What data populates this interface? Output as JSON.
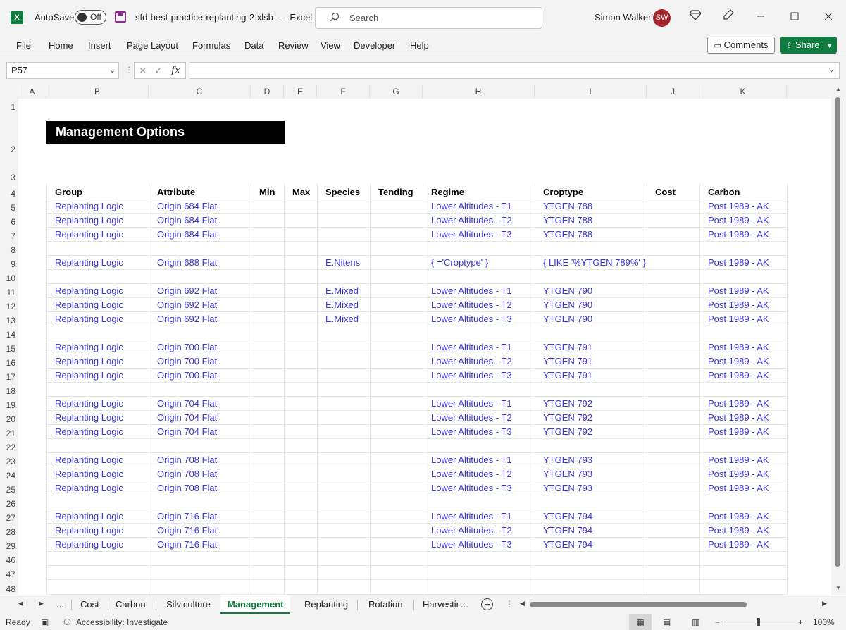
{
  "titlebar": {
    "autosave_label": "AutoSave",
    "autosave_state": "Off",
    "filename": "sfd-best-practice-replanting-2.xlsb",
    "separator": "-",
    "app": "Excel",
    "search_placeholder": "Search",
    "user_name": "Simon Walker",
    "user_initials": "SW",
    "brand_color": "#107c41"
  },
  "menu": {
    "items": [
      "File",
      "Home",
      "Insert",
      "Page Layout",
      "Formulas",
      "Data",
      "Review",
      "View",
      "Developer",
      "Help"
    ],
    "comments": "Comments",
    "share": "Share"
  },
  "formula_bar": {
    "name_box": "P57",
    "fx": "fx",
    "formula": ""
  },
  "columns": [
    "A",
    "B",
    "C",
    "D",
    "E",
    "F",
    "G",
    "H",
    "I",
    "J",
    "K"
  ],
  "row_numbers": [
    "1",
    "2",
    "3",
    "4",
    "5",
    "6",
    "7",
    "8",
    "9",
    "10",
    "11",
    "12",
    "13",
    "14",
    "15",
    "16",
    "17",
    "18",
    "19",
    "20",
    "21",
    "22",
    "23",
    "24",
    "25",
    "26",
    "27",
    "28",
    "29",
    "46",
    "47",
    "48"
  ],
  "sheet": {
    "title": "Management Options",
    "headers": [
      "Group",
      "Attribute",
      "Min",
      "Max",
      "Species",
      "Tending",
      "Regime",
      "Croptype",
      "Cost",
      "Carbon"
    ],
    "rows": [
      [
        "Replanting Logic",
        "Origin 684 Flat",
        "",
        "",
        "",
        "",
        "Lower Altitudes - T1",
        "YTGEN 788",
        "",
        "Post 1989 - AK"
      ],
      [
        "Replanting Logic",
        "Origin 684 Flat",
        "",
        "",
        "",
        "",
        "Lower Altitudes - T2",
        "YTGEN 788",
        "",
        "Post 1989 - AK"
      ],
      [
        "Replanting Logic",
        "Origin 684 Flat",
        "",
        "",
        "",
        "",
        "Lower Altitudes - T3",
        "YTGEN 788",
        "",
        "Post 1989 - AK"
      ],
      [
        "",
        "",
        "",
        "",
        "",
        "",
        "",
        "",
        "",
        ""
      ],
      [
        "Replanting Logic",
        "Origin 688 Flat",
        "",
        "",
        "E.Nitens",
        "",
        "{ ='Croptype' }",
        "{ LIKE '%YTGEN 789%' }",
        "",
        "Post 1989 - AK"
      ],
      [
        "",
        "",
        "",
        "",
        "",
        "",
        "",
        "",
        "",
        ""
      ],
      [
        "Replanting Logic",
        "Origin 692 Flat",
        "",
        "",
        "E.Mixed",
        "",
        "Lower Altitudes - T1",
        "YTGEN 790",
        "",
        "Post 1989 - AK"
      ],
      [
        "Replanting Logic",
        "Origin 692 Flat",
        "",
        "",
        "E.Mixed",
        "",
        "Lower Altitudes - T2",
        "YTGEN 790",
        "",
        "Post 1989 - AK"
      ],
      [
        "Replanting Logic",
        "Origin 692 Flat",
        "",
        "",
        "E.Mixed",
        "",
        "Lower Altitudes - T3",
        "YTGEN 790",
        "",
        "Post 1989 - AK"
      ],
      [
        "",
        "",
        "",
        "",
        "",
        "",
        "",
        "",
        "",
        ""
      ],
      [
        "Replanting Logic",
        "Origin 700 Flat",
        "",
        "",
        "",
        "",
        "Lower Altitudes - T1",
        "YTGEN 791",
        "",
        "Post 1989 - AK"
      ],
      [
        "Replanting Logic",
        "Origin 700 Flat",
        "",
        "",
        "",
        "",
        "Lower Altitudes - T2",
        "YTGEN 791",
        "",
        "Post 1989 - AK"
      ],
      [
        "Replanting Logic",
        "Origin 700 Flat",
        "",
        "",
        "",
        "",
        "Lower Altitudes - T3",
        "YTGEN 791",
        "",
        "Post 1989 - AK"
      ],
      [
        "",
        "",
        "",
        "",
        "",
        "",
        "",
        "",
        "",
        ""
      ],
      [
        "Replanting Logic",
        "Origin 704 Flat",
        "",
        "",
        "",
        "",
        "Lower Altitudes - T1",
        "YTGEN 792",
        "",
        "Post 1989 - AK"
      ],
      [
        "Replanting Logic",
        "Origin 704 Flat",
        "",
        "",
        "",
        "",
        "Lower Altitudes - T2",
        "YTGEN 792",
        "",
        "Post 1989 - AK"
      ],
      [
        "Replanting Logic",
        "Origin 704 Flat",
        "",
        "",
        "",
        "",
        "Lower Altitudes - T3",
        "YTGEN 792",
        "",
        "Post 1989 - AK"
      ],
      [
        "",
        "",
        "",
        "",
        "",
        "",
        "",
        "",
        "",
        ""
      ],
      [
        "Replanting Logic",
        "Origin 708 Flat",
        "",
        "",
        "",
        "",
        "Lower Altitudes - T1",
        "YTGEN 793",
        "",
        "Post 1989 - AK"
      ],
      [
        "Replanting Logic",
        "Origin 708 Flat",
        "",
        "",
        "",
        "",
        "Lower Altitudes - T2",
        "YTGEN 793",
        "",
        "Post 1989 - AK"
      ],
      [
        "Replanting Logic",
        "Origin 708 Flat",
        "",
        "",
        "",
        "",
        "Lower Altitudes - T3",
        "YTGEN 793",
        "",
        "Post 1989 - AK"
      ],
      [
        "",
        "",
        "",
        "",
        "",
        "",
        "",
        "",
        "",
        ""
      ],
      [
        "Replanting Logic",
        "Origin 716 Flat",
        "",
        "",
        "",
        "",
        "Lower Altitudes - T1",
        "YTGEN 794",
        "",
        "Post 1989 - AK"
      ],
      [
        "Replanting Logic",
        "Origin 716 Flat",
        "",
        "",
        "",
        "",
        "Lower Altitudes - T2",
        "YTGEN 794",
        "",
        "Post 1989 - AK"
      ],
      [
        "Replanting Logic",
        "Origin 716 Flat",
        "",
        "",
        "",
        "",
        "Lower Altitudes - T3",
        "YTGEN 794",
        "",
        "Post 1989 - AK"
      ]
    ],
    "link_color": "#3a34d6"
  },
  "tabs": {
    "ellipsis_left": "...",
    "items": [
      "Cost",
      "Carbon",
      "Silviculture",
      "Management",
      "Replanting",
      "Rotation",
      "Harvestir"
    ],
    "active": "Management",
    "ellipsis_right": "..."
  },
  "status": {
    "ready": "Ready",
    "accessibility": "Accessibility: Investigate",
    "zoom": "100%"
  }
}
